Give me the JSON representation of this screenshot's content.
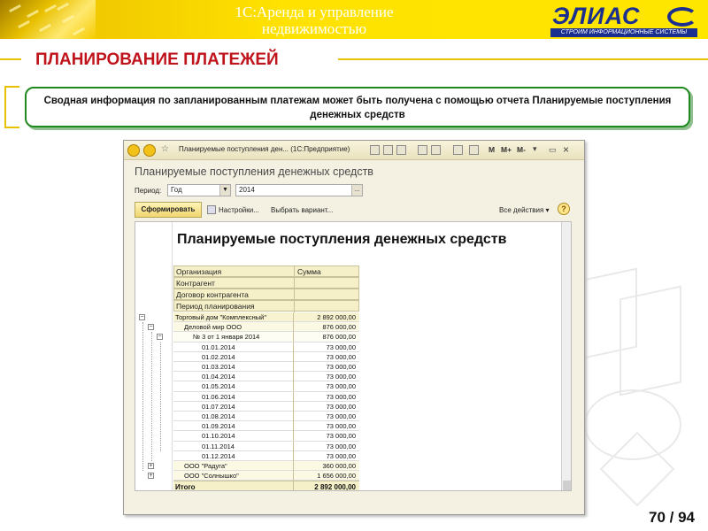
{
  "header": {
    "title_line1": "1С:Аренда и управление",
    "title_line2": "недвижимостью",
    "logo_text": "ЭЛИАС",
    "logo_subtitle": "СТРОИМ ИНФОРМАЦИОННЫЕ СИСТЕМЫ",
    "accent_color": "#ffe200",
    "brand_color": "#1a2f8f"
  },
  "section": {
    "title": "ПЛАНИРОВАНИЕ ПЛАТЕЖЕЙ",
    "title_color": "#c0141c"
  },
  "info": {
    "text": "Сводная информация по запланированным платежам может быть получена с помощью отчета Планируемые поступления денежных средств"
  },
  "window": {
    "title": "Планируемые поступления ден... (1С:Предприятие)",
    "title_buttons": [
      "M",
      "M+",
      "M-"
    ],
    "report_title": "Планируемые поступления денежных средств",
    "period_label": "Период:",
    "period_type": "Год",
    "period_value": "2014",
    "ellipsis": "...",
    "dropdown_arrow": "▼",
    "generate_button": "Сформировать",
    "settings_link": "Настройки...",
    "variant_link": "Выбрать вариант...",
    "actions_link": "Все действия ▾",
    "help_label": "?"
  },
  "report": {
    "heading": "Планируемые поступления денежных средств",
    "groupings": [
      "Организация",
      "Контрагент",
      "Договор контрагента",
      "Период планирования"
    ],
    "sum_header": "Сумма",
    "rows": [
      {
        "level": 0,
        "label": "Торговый дом \"Комплексный\"",
        "value": "2 892 000,00"
      },
      {
        "level": 1,
        "label": "Деловой мир ООО",
        "value": "876 000,00"
      },
      {
        "level": 2,
        "label": "№ 3 от 1 января 2014",
        "value": "876 000,00"
      },
      {
        "level": 3,
        "label": "01.01.2014",
        "value": "73 000,00"
      },
      {
        "level": 3,
        "label": "01.02.2014",
        "value": "73 000,00"
      },
      {
        "level": 3,
        "label": "01.03.2014",
        "value": "73 000,00"
      },
      {
        "level": 3,
        "label": "01.04.2014",
        "value": "73 000,00"
      },
      {
        "level": 3,
        "label": "01.05.2014",
        "value": "73 000,00"
      },
      {
        "level": 3,
        "label": "01.06.2014",
        "value": "73 000,00"
      },
      {
        "level": 3,
        "label": "01.07.2014",
        "value": "73 000,00"
      },
      {
        "level": 3,
        "label": "01.08.2014",
        "value": "73 000,00"
      },
      {
        "level": 3,
        "label": "01.09.2014",
        "value": "73 000,00"
      },
      {
        "level": 3,
        "label": "01.10.2014",
        "value": "73 000,00"
      },
      {
        "level": 3,
        "label": "01.11.2014",
        "value": "73 000,00"
      },
      {
        "level": 3,
        "label": "01.12.2014",
        "value": "73 000,00"
      },
      {
        "level": 1,
        "label": "ООО \"Радуга\"",
        "value": "360 000,00"
      },
      {
        "level": 1,
        "label": "ООО \"Солнышко\"",
        "value": "1 656 000,00"
      }
    ],
    "total_label": "Итого",
    "total_value": "2 892 000,00"
  },
  "page_number": "70 / 94"
}
